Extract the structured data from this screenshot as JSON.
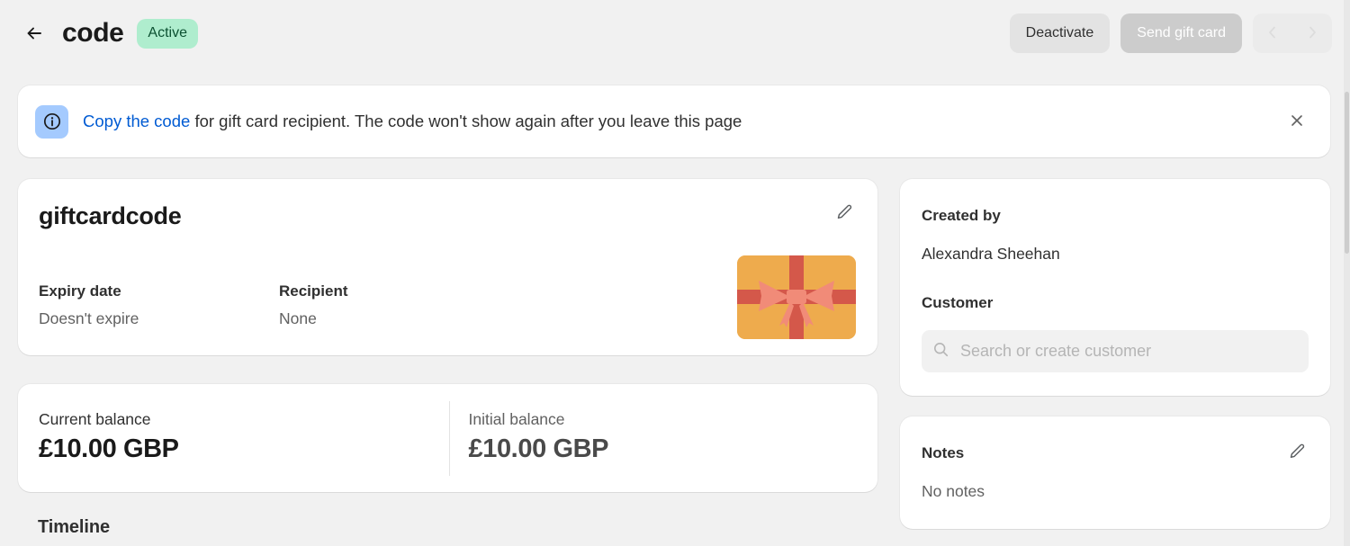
{
  "header": {
    "back_icon": "arrow-left-icon",
    "title": "code",
    "status_badge": "Active",
    "status_badge_bg": "#afedce",
    "status_badge_color": "#0c5132",
    "deactivate_label": "Deactivate",
    "send_gift_card_label": "Send gift card",
    "prev_icon": "chevron-left-icon",
    "next_icon": "chevron-right-icon"
  },
  "banner": {
    "icon": "info-circle-icon",
    "icon_bg": "#a4cafe",
    "link_text": "Copy the code",
    "link_color": "#005bd3",
    "message": " for gift card recipient. The code won't show again after you leave this page",
    "close_icon": "close-icon"
  },
  "gift_card": {
    "code": "giftcardcode",
    "edit_icon": "pencil-icon",
    "fields": [
      {
        "label": "Expiry date",
        "value": "Doesn't expire"
      },
      {
        "label": "Recipient",
        "value": "None"
      }
    ],
    "image_alt": "gift-card-illustration",
    "image_colors": {
      "background": "#eeab4d",
      "ribbon": "#d4584a",
      "bow": "#f18b78"
    }
  },
  "balances": {
    "current_label": "Current balance",
    "current_value": "£10.00 GBP",
    "initial_label": "Initial balance",
    "initial_value": "£10.00 GBP"
  },
  "timeline": {
    "title": "Timeline"
  },
  "sidebar": {
    "created_by_label": "Created by",
    "created_by_value": "Alexandra Sheehan",
    "customer_label": "Customer",
    "customer_search_placeholder": "Search or create customer",
    "customer_search_value": "",
    "customer_search_icon": "search-icon",
    "notes_label": "Notes",
    "notes_value": "No notes",
    "notes_edit_icon": "pencil-icon"
  }
}
